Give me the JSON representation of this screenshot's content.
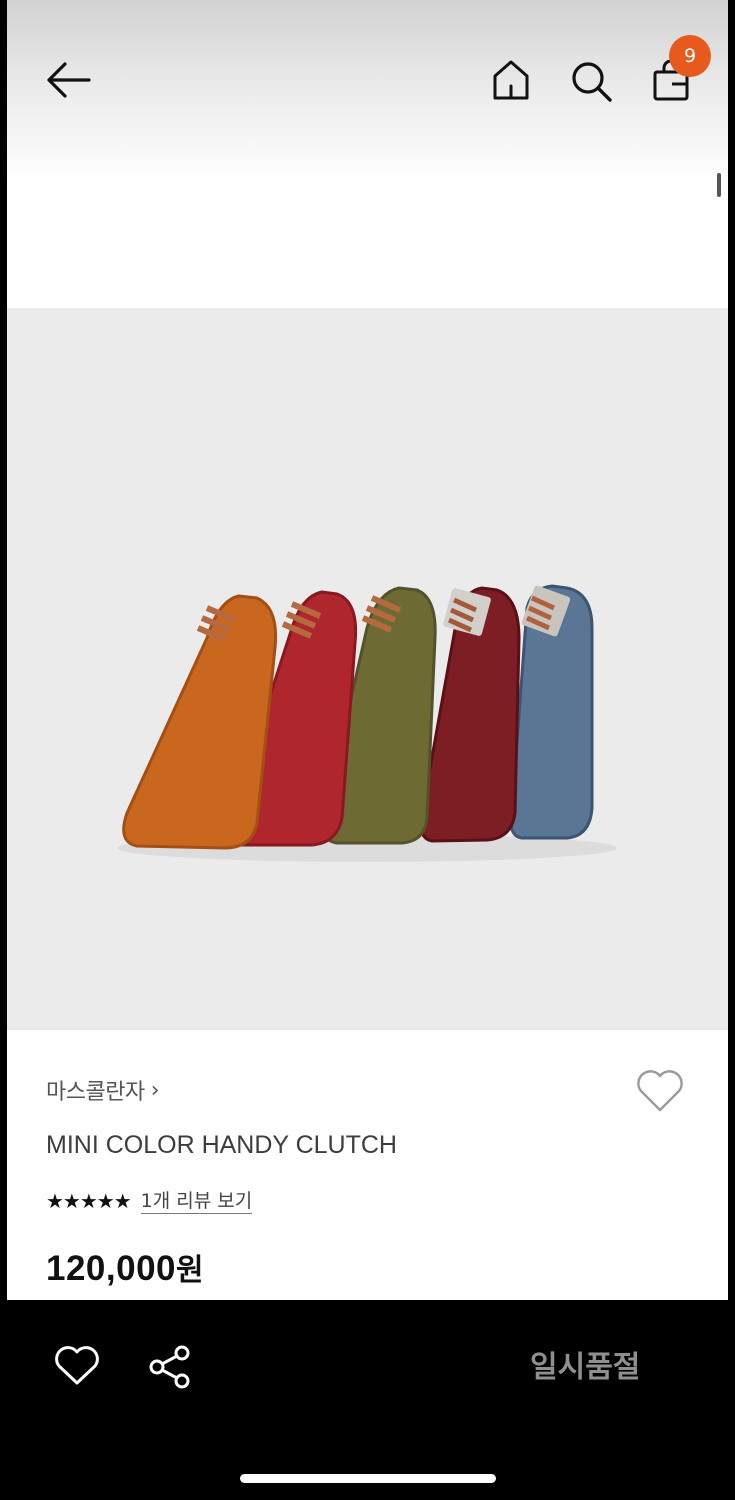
{
  "header": {
    "back_icon": "arrow-left-icon",
    "home_icon": "home-icon",
    "search_icon": "search-icon",
    "cart_icon": "shopping-bag-icon",
    "cart_count": "9",
    "badge_color": "#e85a1b"
  },
  "product_image": {
    "colors": [
      "#c8661e",
      "#b3262e",
      "#6e6b33",
      "#7a1f22",
      "#56708f"
    ]
  },
  "product": {
    "brand": "마스콜란자",
    "brand_chevron": "›",
    "name": "MINI COLOR HANDY CLUTCH",
    "rating_stars": "★★★★★",
    "rating": 5,
    "review_link": "1개 리뷰 보기",
    "price": "120,000",
    "price_unit": "원",
    "wishlist_icon": "heart-outline-icon"
  },
  "bottom_bar": {
    "wishlist_icon": "heart-outline-icon",
    "share_icon": "share-icon",
    "status_button": "일시품절"
  }
}
